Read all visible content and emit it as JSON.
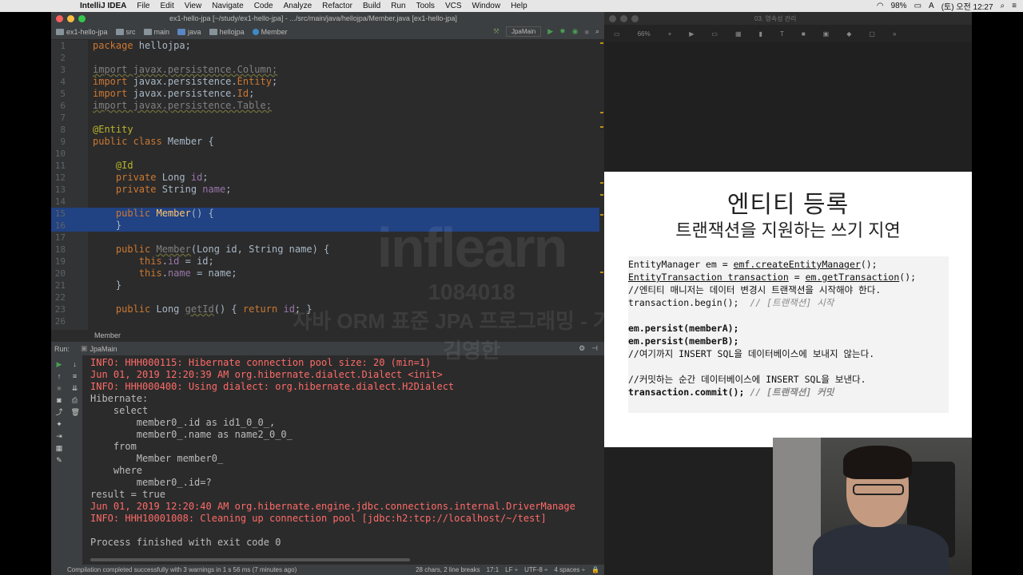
{
  "menubar": {
    "app": "IntelliJ IDEA",
    "items": [
      "File",
      "Edit",
      "View",
      "Navigate",
      "Code",
      "Analyze",
      "Refactor",
      "Build",
      "Run",
      "Tools",
      "VCS",
      "Window",
      "Help"
    ],
    "battery": "98%",
    "input_method": "A",
    "clock": "(토) 오전 12:27"
  },
  "ide": {
    "window_title": "ex1-hello-jpa [~/study/ex1-hello-jpa] - .../src/main/java/hellojpa/Member.java [ex1-hello-jpa]",
    "breadcrumbs": [
      "ex1-hello-jpa",
      "src",
      "main",
      "java",
      "hellojpa",
      "Member"
    ],
    "run_config": "JpaMain",
    "editor_lines": [
      {
        "n": "1",
        "html": "<span class='kw'>package</span> hellojpa;"
      },
      {
        "n": "2",
        "html": ""
      },
      {
        "n": "3",
        "html": "<span class='gr'>import javax.persistence.Column;</span>"
      },
      {
        "n": "4",
        "html": "<span class='kw'>import</span> javax.persistence.<span class='kw'>Entity</span>;"
      },
      {
        "n": "5",
        "html": "<span class='kw'>import</span> javax.persistence.<span class='kw'>Id</span>;"
      },
      {
        "n": "6",
        "html": "<span class='gr'>import javax.persistence.Table;</span>"
      },
      {
        "n": "7",
        "html": ""
      },
      {
        "n": "8",
        "html": "<span class='an'>@Entity</span>"
      },
      {
        "n": "9",
        "html": "<span class='kw'>public class</span> Member {"
      },
      {
        "n": "10",
        "html": ""
      },
      {
        "n": "11",
        "html": "    <span class='an'>@Id</span>"
      },
      {
        "n": "12",
        "html": "    <span class='kw'>private</span> Long <span class='fd'>id</span>;"
      },
      {
        "n": "13",
        "html": "    <span class='kw'>private</span> String <span class='fd'>name</span>;"
      },
      {
        "n": "14",
        "html": ""
      },
      {
        "n": "15",
        "html": "    <span class='kw'>public</span> <span class='fn'>Member</span>() {"
      },
      {
        "n": "16",
        "html": "    }"
      },
      {
        "n": "17",
        "html": ""
      },
      {
        "n": "18",
        "html": "    <span class='kw'>public</span> <span class='gr'>Member</span>(Long id, String name) {"
      },
      {
        "n": "19",
        "html": "        <span class='kw'>this</span>.<span class='fd'>id</span> = id;"
      },
      {
        "n": "20",
        "html": "        <span class='kw'>this</span>.<span class='fd'>name</span> = name;"
      },
      {
        "n": "21",
        "html": "    }"
      },
      {
        "n": "22",
        "html": ""
      },
      {
        "n": "23",
        "html": "    <span class='kw'>public</span> Long <span class='gr'>getId</span>() { <span class='kw'>return</span> <span class='fd'>id</span>; }"
      },
      {
        "n": "26",
        "html": ""
      }
    ],
    "editor_footer": "Member",
    "run_label": "Run:",
    "run_tab": "JpaMain",
    "console_lines": [
      {
        "t": "INFO: HHH000115: Hibernate connection pool size: 20 (min=1)",
        "red": true
      },
      {
        "t": "Jun 01, 2019 12:20:39 AM org.hibernate.dialect.Dialect <init>",
        "red": true
      },
      {
        "t": "INFO: HHH000400: Using dialect: org.hibernate.dialect.H2Dialect",
        "red": true
      },
      {
        "t": "Hibernate: ",
        "red": false
      },
      {
        "t": "    select",
        "red": false
      },
      {
        "t": "        member0_.id as id1_0_0_,",
        "red": false
      },
      {
        "t": "        member0_.name as name2_0_0_ ",
        "red": false
      },
      {
        "t": "    from",
        "red": false
      },
      {
        "t": "        Member member0_ ",
        "red": false
      },
      {
        "t": "    where",
        "red": false
      },
      {
        "t": "        member0_.id=?",
        "red": false
      },
      {
        "t": "result = true",
        "red": false
      },
      {
        "t": "Jun 01, 2019 12:20:40 AM org.hibernate.engine.jdbc.connections.internal.DriverManage",
        "red": true
      },
      {
        "t": "INFO: HHH10001008: Cleaning up connection pool [jdbc:h2:tcp://localhost/~/test]",
        "red": true
      },
      {
        "t": "",
        "red": false
      },
      {
        "t": "Process finished with exit code 0",
        "red": false
      }
    ],
    "status_left": "Compilation completed successfully with 3 warnings in 1 s 56 ms (7 minutes ago)",
    "status_right": [
      "28 chars, 2 line breaks",
      "17:1",
      "LF ÷",
      "UTF-8 ÷",
      "4 spaces ÷"
    ]
  },
  "keynote": {
    "window_title": "03. 영속성 관리",
    "zoom": "66%",
    "slide_title": "엔티티 등록",
    "slide_subtitle": "트랜잭션을 지원하는 쓰기 지연",
    "code_lines": [
      {
        "html": "EntityManager em = <span class='ul'>emf.createEntityManager</span>();",
        "bold": false
      },
      {
        "html": "<span class='ul'>EntityTransaction transaction</span> = <span class='ul'>em.getTransaction</span>();",
        "bold": false
      },
      {
        "html": "//엔티티 매니저는 데이터 변경시 트랜잭션을 시작해야 한다.",
        "bold": false
      },
      {
        "html": "transaction.begin();  <span class='cm'>// [트랜잭션] 시작</span>",
        "bold": false
      },
      {
        "html": "",
        "bold": false
      },
      {
        "html": "em.persist(memberA);",
        "bold": true
      },
      {
        "html": "em.persist(memberB);",
        "bold": true
      },
      {
        "html": "//여기까지 INSERT SQL을 데이터베이스에 보내지 않는다.",
        "bold": false
      },
      {
        "html": "",
        "bold": false
      },
      {
        "html": "//커밋하는 순간 데이터베이스에 INSERT SQL을 보낸다.",
        "bold": false
      },
      {
        "html": "transaction.commit(); <span class='cm'>// [트랜잭션] 커밋</span>",
        "bold": true
      }
    ]
  },
  "watermark": {
    "brand": "inflearn",
    "id": "1084018",
    "course": "자바 ORM 표준 JPA 프로그래밍 - 기본편",
    "name": "김영한"
  },
  "colors": {
    "ide_bg": "#2b2b2b",
    "selection": "#214283",
    "keyword": "#cc7832",
    "annotation": "#bbb529",
    "error": "#ff6b68"
  }
}
